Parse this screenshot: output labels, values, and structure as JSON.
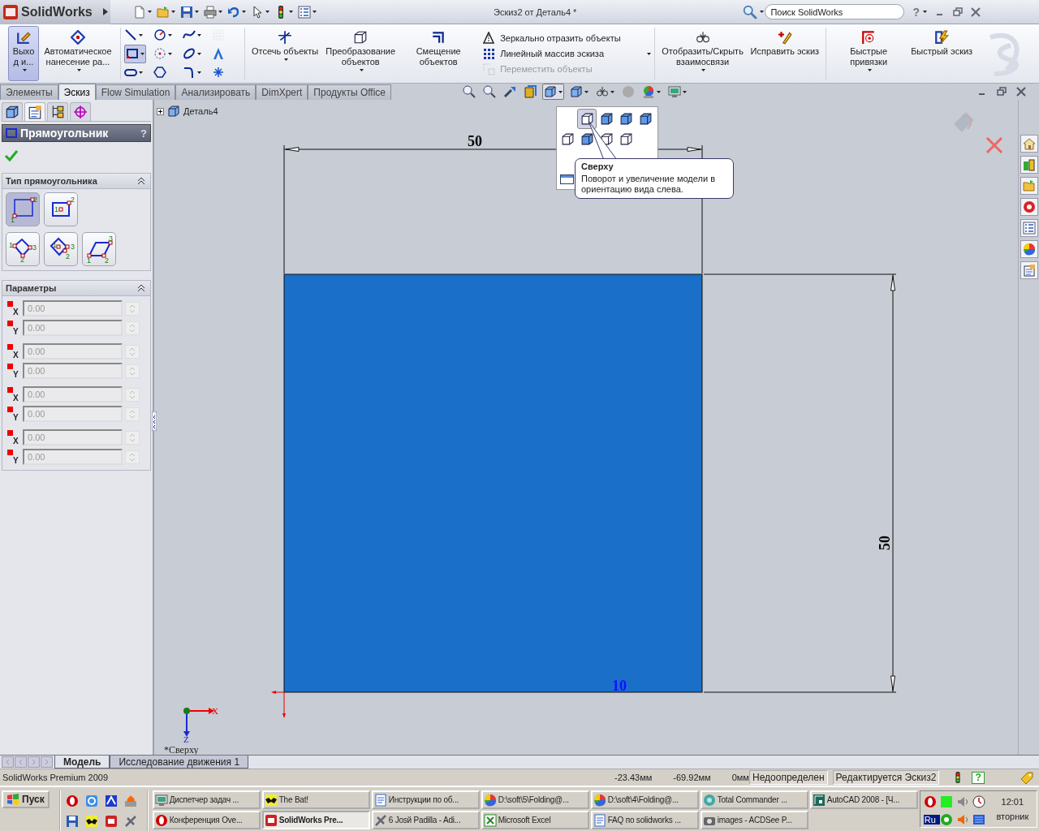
{
  "window": {
    "app_name": "SolidWorks",
    "title": "Эскиз2 от Деталь4 *",
    "help_label": "?"
  },
  "search": {
    "placeholder": "Поиск SolidWorks"
  },
  "ribbon": {
    "left_commands": [
      {
        "label": "Выход и...",
        "selected": true
      },
      {
        "label": "Автоматическое нанесение ра...",
        "selected": false
      }
    ],
    "edit_commands": [
      {
        "label": "Отсечь объекты"
      },
      {
        "label": "Преобразование объектов"
      },
      {
        "label": "Смещение объектов"
      }
    ],
    "list_commands": [
      {
        "label": "Зеркально отразить объекты",
        "disabled": false
      },
      {
        "label": "Линейный массив эскиза",
        "disabled": false
      },
      {
        "label": "Переместить объекты",
        "disabled": true
      }
    ],
    "right_commands": [
      {
        "label": "Отобразить/Скрыть взаимосвязи"
      },
      {
        "label": "Исправить эскиз"
      },
      {
        "label": "Быстрые привязки"
      },
      {
        "label": "Быстрый эскиз"
      }
    ]
  },
  "tabs": [
    {
      "label": "Элементы",
      "selected": false
    },
    {
      "label": "Эскиз",
      "selected": true
    },
    {
      "label": "Flow Simulation",
      "selected": false
    },
    {
      "label": "Анализировать",
      "selected": false
    },
    {
      "label": "DimXpert",
      "selected": false
    },
    {
      "label": "Продукты Office",
      "selected": false
    }
  ],
  "property_manager": {
    "title": "Прямоугольник",
    "help_label": "?",
    "type_section": {
      "title": "Тип прямоугольника",
      "options": [
        {
          "kind": "corner",
          "selected": true,
          "points": [
            "1",
            "2"
          ]
        },
        {
          "kind": "center",
          "selected": false,
          "points": [
            "1",
            "2"
          ]
        },
        {
          "kind": "three-point-corner",
          "selected": false,
          "points": [
            "1",
            "2",
            "3"
          ]
        },
        {
          "kind": "three-point-center",
          "selected": false,
          "points": [
            "1",
            "2",
            "3"
          ]
        },
        {
          "kind": "parallelogram",
          "selected": false,
          "points": [
            "1",
            "2",
            "3"
          ]
        }
      ]
    },
    "parameters_section": {
      "title": "Параметры",
      "fields": [
        {
          "axis": "X",
          "value": "0.00",
          "disabled": true
        },
        {
          "axis": "Y",
          "value": "0.00",
          "disabled": true
        },
        {
          "axis": "X",
          "value": "0.00",
          "disabled": true
        },
        {
          "axis": "Y",
          "value": "0.00",
          "disabled": true
        },
        {
          "axis": "X",
          "value": "0.00",
          "disabled": true
        },
        {
          "axis": "Y",
          "value": "0.00",
          "disabled": true
        },
        {
          "axis": "X",
          "value": "0.00",
          "disabled": true
        },
        {
          "axis": "Y",
          "value": "0.00",
          "disabled": true
        }
      ]
    }
  },
  "graphics": {
    "tree_root": "Деталь4",
    "horizontal_dimension": "50",
    "vertical_dimension": "50",
    "point_label": "10",
    "view_name": "*Сверху",
    "triad_labels": [
      "X",
      "Z"
    ],
    "tooltip": {
      "title": "Сверху",
      "text": "Поворот и увеличение модели в ориентацию вида слева."
    }
  },
  "bottom_tabs": [
    {
      "label": "Модель",
      "selected": true
    },
    {
      "label": "Исследование движения 1",
      "selected": false
    }
  ],
  "status_bar": {
    "product": "SolidWorks Premium 2009",
    "coordinates": [
      "-23.43мм",
      "-69.92мм",
      "0мм"
    ],
    "definition": "Недоопределен",
    "mode": "Редактируется Эскиз2",
    "help_label": "?"
  },
  "taskbar": {
    "start": "Пуск",
    "tasks": [
      {
        "label": "Диспетчер задач ...",
        "selected": false
      },
      {
        "label": "The Bat!",
        "selected": false
      },
      {
        "label": "Инструкции по об...",
        "selected": false
      },
      {
        "label": "D:\\soft\\5\\Folding@...",
        "selected": false
      },
      {
        "label": "D:\\soft\\4\\Folding@...",
        "selected": false
      },
      {
        "label": "Total Commander ...",
        "selected": false
      },
      {
        "label": "AutoCAD 2008 - [Ч...",
        "selected": false
      },
      {
        "label": "Конференция Ove...",
        "selected": false
      },
      {
        "label": "SolidWorks Pre...",
        "selected": true
      },
      {
        "label": "6 Josй Padilla - Adi...",
        "selected": false
      },
      {
        "label": "Microsoft Excel",
        "selected": false
      },
      {
        "label": "FAQ по solidworks ...",
        "selected": false
      },
      {
        "label": "images - ACDSee P...",
        "selected": false
      }
    ],
    "language": "Ru",
    "time": "12:01",
    "day": "вторник"
  }
}
